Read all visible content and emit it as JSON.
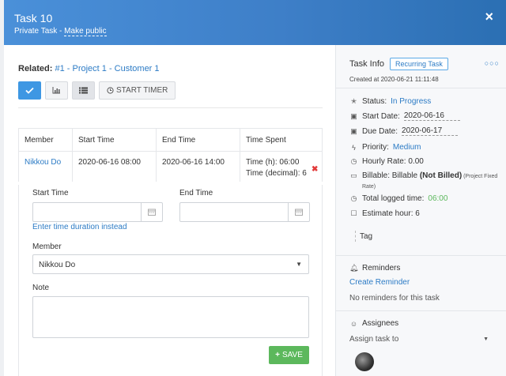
{
  "header": {
    "title": "Task 10",
    "subtitle_prefix": "Private Task - ",
    "make_public": "Make public",
    "close": "×"
  },
  "related": {
    "label": "Related:",
    "link": "#1 - Project 1 - Customer 1"
  },
  "toolbar": {
    "start_timer": "START TIMER"
  },
  "timesheet": {
    "columns": [
      "Member",
      "Start Time",
      "End Time",
      "Time Spent"
    ],
    "row": {
      "member": "Nikkou Do",
      "start": "2020-06-16 08:00",
      "end": "2020-06-16 14:00",
      "time_h": "Time (h): 06:00",
      "time_decimal": "Time (decimal): 6"
    }
  },
  "edit_form": {
    "start_time_label": "Start Time",
    "end_time_label": "End Time",
    "duration_link": "Enter time duration instead",
    "member_label": "Member",
    "member_value": "Nikkou Do",
    "note_label": "Note",
    "save": "SAVE"
  },
  "info": {
    "title": "Task Info",
    "badge": "Recurring Task",
    "created": "Created at 2020-06-21 11:11:48",
    "status_label": "Status:",
    "status_value": "In Progress",
    "start_label": "Start Date:",
    "start_value": "2020-06-16",
    "due_label": "Due Date:",
    "due_value": "2020-06-17",
    "priority_label": "Priority:",
    "priority_value": "Medium",
    "hourly_label": "Hourly Rate: 0.00",
    "billable_prefix": "Billable: Billable ",
    "billable_bold": "(Not Billed)",
    "billable_note": " (Project Fixed Rate)",
    "logged_label": "Total logged time:",
    "logged_value": "06:00",
    "estimate_label": "Estimate hour: 6",
    "tag_placeholder": "Tag",
    "reminders_title": "Reminders",
    "create_reminder": "Create Reminder",
    "no_reminders": "No reminders for this task",
    "assignees_title": "Assignees",
    "assign_placeholder": "Assign task to"
  }
}
